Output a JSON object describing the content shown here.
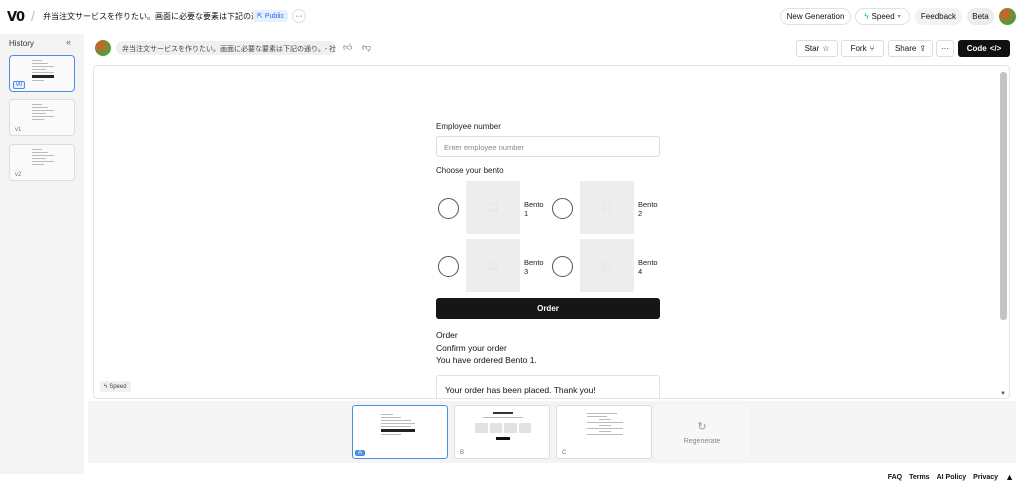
{
  "header": {
    "logo": "V0",
    "title": "弁当注文サービスを作りたい。画面に必要な要素は下記の通り。- ...",
    "public_label": "Public",
    "more": "···",
    "new_generation": "New Generation",
    "speed": "Speed",
    "feedback": "Feedback",
    "beta": "Beta"
  },
  "sidebar": {
    "title": "History",
    "versions": [
      "v0",
      "v1",
      "v2"
    ]
  },
  "chat": {
    "message": "弁当注文サービスを作りたい。画面に必要な要素は下記の通り。- 社...",
    "star": "Star",
    "fork": "Fork",
    "share": "Share",
    "more": "···",
    "code": "Code"
  },
  "preview": {
    "employee_label": "Employee number",
    "employee_placeholder": "Enter employee number",
    "choose_label": "Choose your bento",
    "bentos": [
      {
        "line1": "Bento",
        "line2": "1"
      },
      {
        "line1": "Bento",
        "line2": "2"
      },
      {
        "line1": "Bento",
        "line2": "3"
      },
      {
        "line1": "Bento",
        "line2": "4"
      }
    ],
    "order_button": "Order",
    "result_title": "Order",
    "result_confirm": "Confirm your order",
    "result_text": "You have ordered Bento 1.",
    "placed_text": "Your order has been placed. Thank you!",
    "speed_chip": "Speed"
  },
  "generations": {
    "tags": [
      "A",
      "B",
      "C"
    ],
    "regenerate": "Regenerate"
  },
  "footer": {
    "links": [
      "FAQ",
      "Terms",
      "AI Policy",
      "Privacy"
    ]
  }
}
